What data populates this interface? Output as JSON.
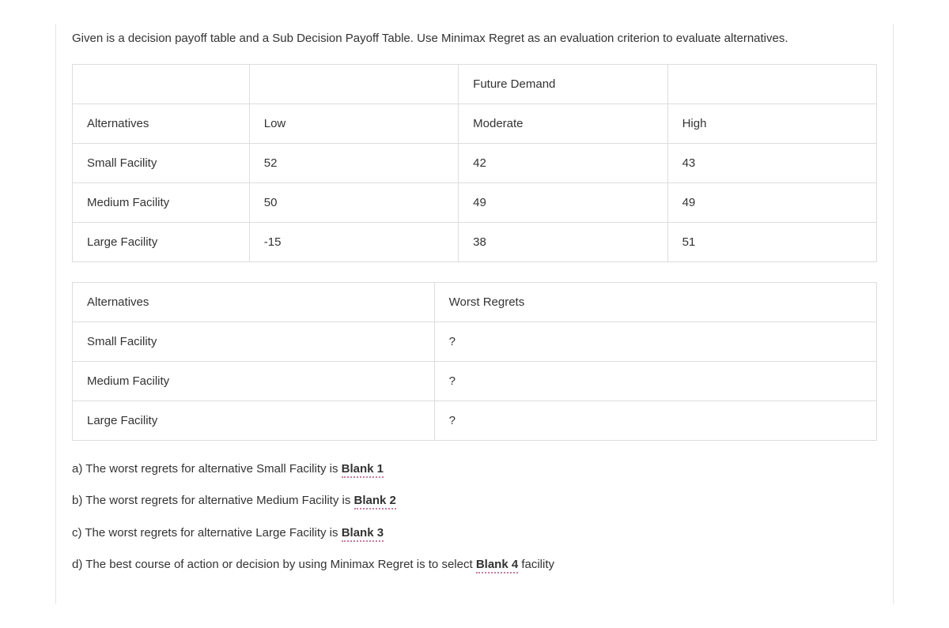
{
  "intro": "Given is a decision payoff table and a Sub Decision Payoff Table. Use Minimax Regret as an evaluation criterion to evaluate alternatives.",
  "payoff_table": {
    "header_top": {
      "c1": "",
      "c2": "",
      "c3": "Future Demand",
      "c4": ""
    },
    "header": {
      "c1": "Alternatives",
      "c2": "Low",
      "c3": "Moderate",
      "c4": "High"
    },
    "rows": [
      {
        "c1": "Small Facility",
        "c2": "52",
        "c3": "42",
        "c4": "43"
      },
      {
        "c1": "Medium Facility",
        "c2": "50",
        "c3": "49",
        "c4": "49"
      },
      {
        "c1": "Large Facility",
        "c2": "-15",
        "c3": "38",
        "c4": "51"
      }
    ]
  },
  "regret_table": {
    "header": {
      "c1": "Alternatives",
      "c2": "Worst Regrets"
    },
    "rows": [
      {
        "c1": "Small Facility",
        "c2": "?"
      },
      {
        "c1": "Medium Facility",
        "c2": "?"
      },
      {
        "c1": "Large Facility",
        "c2": "?"
      }
    ]
  },
  "questions": {
    "a_pre": "a) The worst regrets for alternative Small Facility is ",
    "a_blank": "Blank 1",
    "b_pre": "b) The worst regrets for alternative Medium Facility is ",
    "b_blank": "Blank 2",
    "c_pre": "c) The worst regrets for alternative Large Facility is ",
    "c_blank": "Blank 3",
    "d_pre": "d) The best course of action or decision by using Minimax Regret is to select ",
    "d_blank": "Blank 4",
    "d_post": " facility"
  }
}
